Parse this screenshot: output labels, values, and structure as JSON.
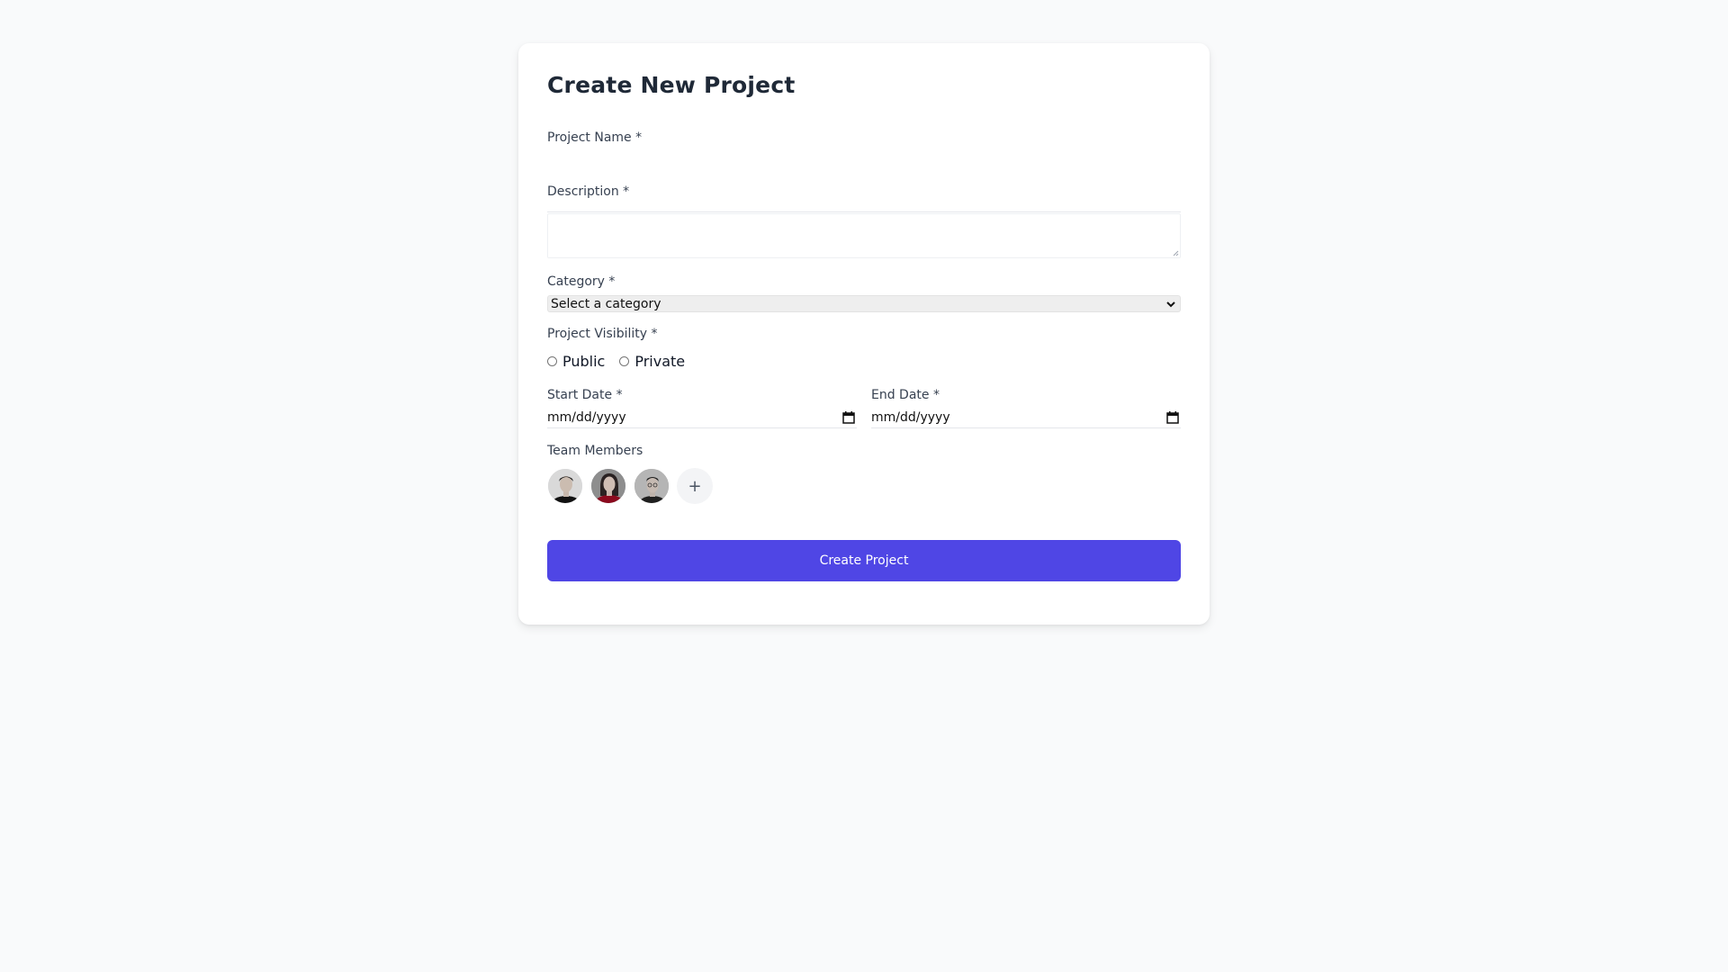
{
  "form": {
    "title": "Create New Project",
    "project_name": {
      "label": "Project Name *",
      "value": "",
      "placeholder": ""
    },
    "description": {
      "label": "Description *",
      "value": "",
      "placeholder": ""
    },
    "category": {
      "label": "Category *",
      "selected": "Select a category"
    },
    "visibility": {
      "label": "Project Visibility *",
      "options": [
        "Public",
        "Private"
      ],
      "selected": null
    },
    "start_date": {
      "label": "Start Date *",
      "value": "mm/dd/yyyy"
    },
    "end_date": {
      "label": "End Date *",
      "value": "mm/dd/yyyy"
    },
    "team": {
      "label": "Team Members",
      "members": [
        {
          "icon": "avatar-man-dark-shirt",
          "bg": "#d1d5db",
          "shirt": "#111111"
        },
        {
          "icon": "avatar-woman-red-top",
          "bg": "#9ca3af",
          "shirt": "#8b0a1e"
        },
        {
          "icon": "avatar-man-glasses",
          "bg": "#a3a3a3",
          "shirt": "#1f1f1f"
        }
      ],
      "add_label": "+"
    },
    "submit_label": "Create Project"
  },
  "colors": {
    "page_bg": "#f9fafb",
    "card_bg": "#ffffff",
    "accent": "#4f46e5"
  }
}
